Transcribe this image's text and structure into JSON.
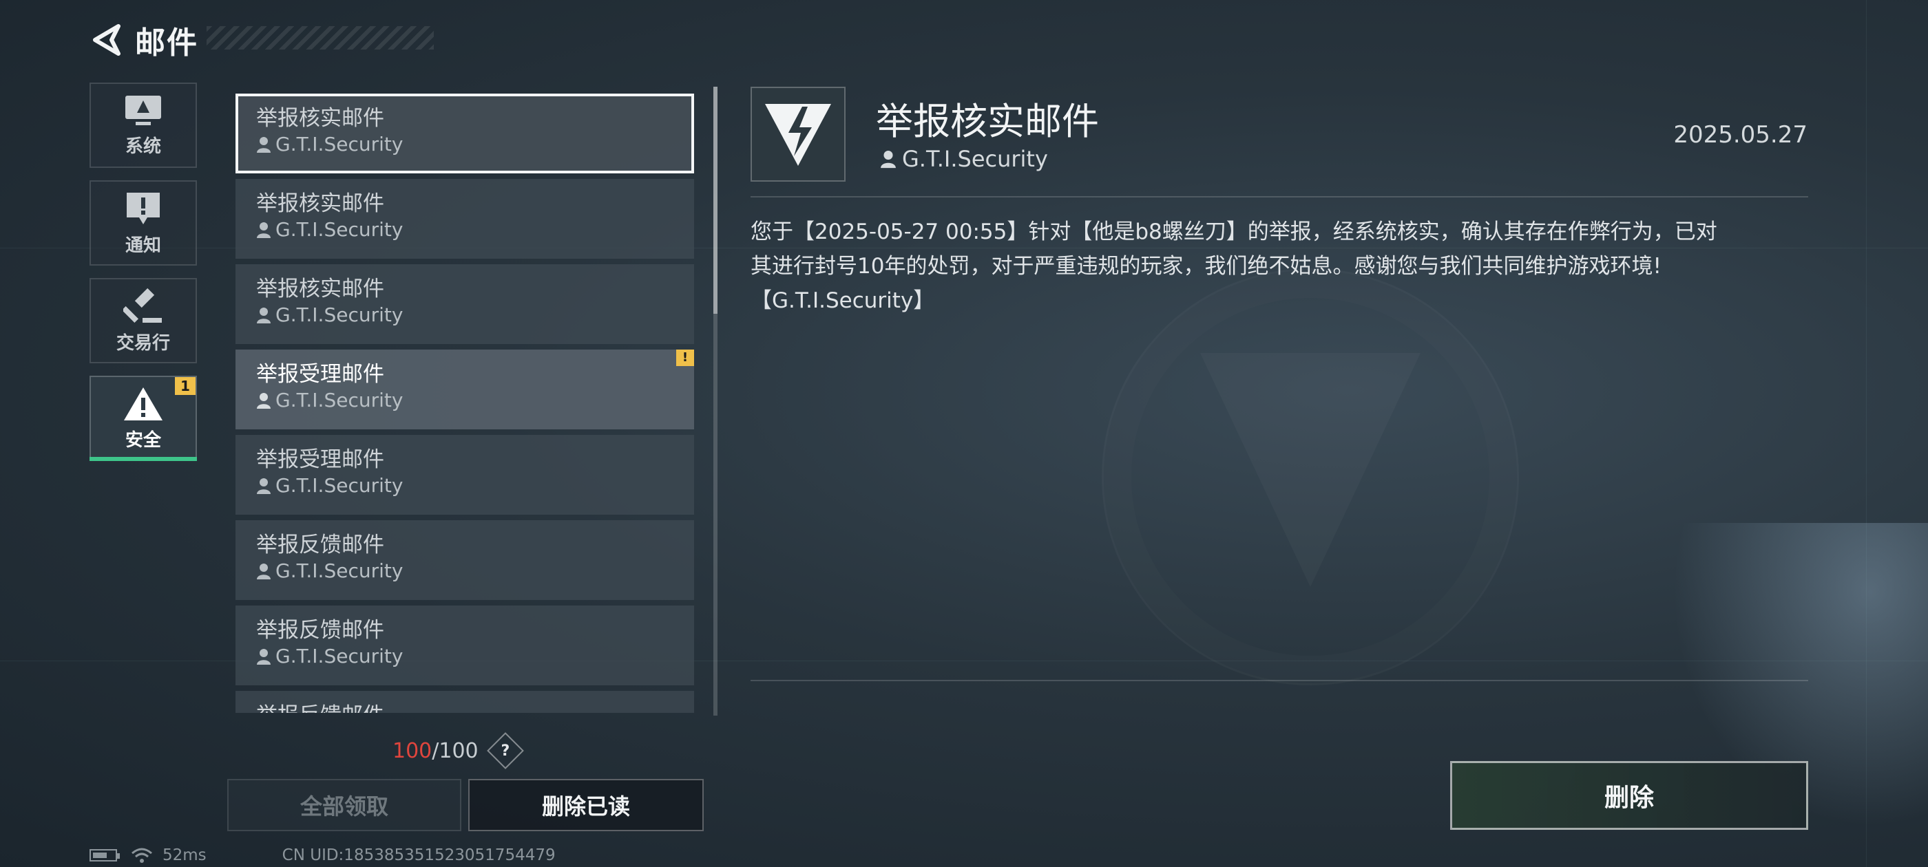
{
  "header": {
    "title": "邮件",
    "back_icon": "back-arrow-icon"
  },
  "categories": [
    {
      "label": "系统",
      "icon": "monitor-icon"
    },
    {
      "label": "通知",
      "icon": "exclamation-bubble-icon"
    },
    {
      "label": "交易行",
      "icon": "gavel-icon"
    },
    {
      "label": "安全",
      "icon": "warning-triangle-icon",
      "badge": "1",
      "active": true
    }
  ],
  "mails": [
    {
      "subject": "举报核实邮件",
      "sender": "G.T.I.Security",
      "selected": true
    },
    {
      "subject": "举报核实邮件",
      "sender": "G.T.I.Security"
    },
    {
      "subject": "举报核实邮件",
      "sender": "G.T.I.Security"
    },
    {
      "subject": "举报受理邮件",
      "sender": "G.T.I.Security",
      "unread": true,
      "badge": "!"
    },
    {
      "subject": "举报受理邮件",
      "sender": "G.T.I.Security"
    },
    {
      "subject": "举报反馈邮件",
      "sender": "G.T.I.Security"
    },
    {
      "subject": "举报反馈邮件",
      "sender": "G.T.I.Security"
    },
    {
      "subject": "举报反馈邮件",
      "sender": ""
    }
  ],
  "counter": {
    "used": "100",
    "total": "/100",
    "help": "?"
  },
  "buttons": {
    "claim_all": "全部领取",
    "delete_read": "删除已读",
    "delete": "删除"
  },
  "status_bar": {
    "ping": "52ms",
    "uid": "CN UID:185385351523051754479"
  },
  "detail": {
    "title": "举报核实邮件",
    "sender": "G.T.I.Security",
    "date": "2025.05.27",
    "body": "您于【2025-05-27 00:55】针对【他是b8螺丝刀】的举报，经系统核实，确认其存在作弊行为，已对\n其进行封号10年的处罚，对于严重违规的玩家，我们绝不姑息。感谢您与我们共同维护游戏环境!\n【G.T.I.Security】"
  },
  "colors": {
    "accent_green": "#3ec48a",
    "badge_yellow": "#f0c04a",
    "counter_red": "#e0453d"
  }
}
